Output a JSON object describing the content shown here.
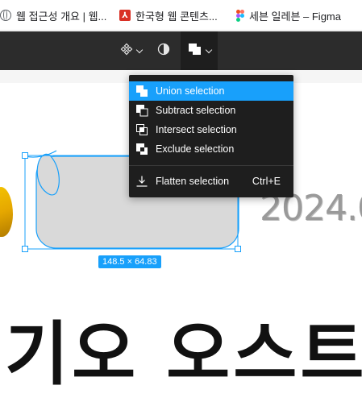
{
  "bookmarks": [
    {
      "label": "웹 접근성 개요 | 웹...",
      "icon": "globe-icon"
    },
    {
      "label": "한국형 웹 콘텐츠...",
      "icon": "pdf-icon"
    },
    {
      "label": "세븐 일레븐 – Figma",
      "icon": "figma-icon"
    }
  ],
  "toolbar": {
    "components_icon": "component-icon",
    "mask_icon": "mask-icon",
    "boolean_icon": "boolean-union-icon"
  },
  "menu": {
    "items": [
      {
        "label": "Union selection",
        "icon": "union-icon",
        "highlighted": true
      },
      {
        "label": "Subtract selection",
        "icon": "subtract-icon"
      },
      {
        "label": "Intersect selection",
        "icon": "intersect-icon"
      },
      {
        "label": "Exclude selection",
        "icon": "exclude-icon"
      }
    ],
    "flatten": {
      "label": "Flatten selection",
      "shortcut": "Ctrl+E",
      "icon": "flatten-icon"
    }
  },
  "canvas": {
    "date_text": "2024.0",
    "big_text": "기오 오스트",
    "selection_size": "148.5 × 64.83"
  },
  "colors": {
    "selection": "#18a0fb",
    "toolbar": "#2c2c2c",
    "menu": "#1e1e1e"
  }
}
